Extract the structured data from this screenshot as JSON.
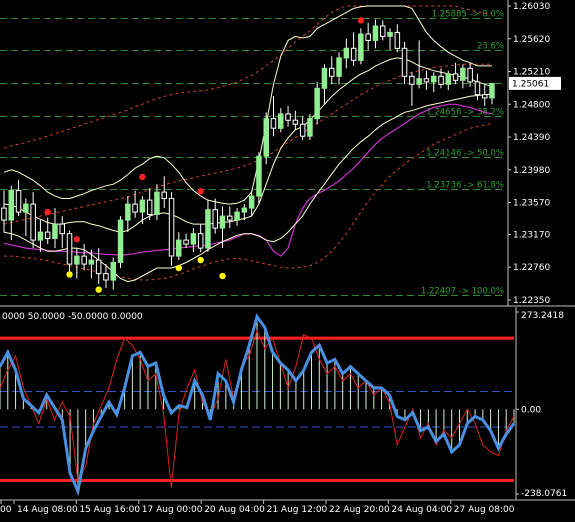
{
  "colors": {
    "background": "#000000",
    "frame": "#c0c0c0",
    "price_axis_text": "#ffffff",
    "fib_level": "#2e8b2e",
    "fib_label": "#2ea02e",
    "candle_bull": "#90ee90",
    "candle_bear": "#000000",
    "candle_wick": "#ffffff",
    "bollinger_inner": "#ffffd0",
    "bollinger_outer": "#cc4422",
    "envelope_low": "#cc33cc",
    "fractal_up": "#ff2020",
    "fractal_down": "#ffff00",
    "osc_main": "#4a90e2",
    "osc_signal": "#dd2222",
    "osc_bars": "#d0f0d0",
    "osc_band": "#ff2020",
    "osc_level": "#3355cc",
    "current_price_box": "#ffffff"
  },
  "chart_data": [
    {
      "type": "candlestick",
      "panel": "price",
      "y_ticks": [
        "1.26030",
        "1.25620",
        "1.25210",
        "1.24800",
        "1.24390",
        "1.23980",
        "1.23570",
        "1.23170",
        "1.22760",
        "1.22350"
      ],
      "ylim": [
        1.2235,
        1.2603
      ],
      "current_price": "1.25061",
      "fib_levels": [
        {
          "price": 1.25885,
          "label": "1.25885 -> 0.0%"
        },
        {
          "price": 1.25475,
          "label": "23.6%"
        },
        {
          "price": 1.25066,
          "label": ""
        },
        {
          "price": 1.24656,
          "label": "1.24656 -> 38.2%"
        },
        {
          "price": 1.24146,
          "label": "1.24146 -> 50.0%"
        },
        {
          "price": 1.23736,
          "label": "1.23736 -> 61.8%"
        },
        {
          "price": 1.22407,
          "label": "1.22407 -> 100.0%"
        }
      ],
      "candles": [
        [
          1.235,
          1.2372,
          1.232,
          1.2335
        ],
        [
          1.2335,
          1.2378,
          1.231,
          1.2372
        ],
        [
          1.2372,
          1.2385,
          1.234,
          1.2345
        ],
        [
          1.2345,
          1.2362,
          1.2315,
          1.2355
        ],
        [
          1.2355,
          1.237,
          1.23,
          1.231
        ],
        [
          1.231,
          1.2335,
          1.2295,
          1.232
        ],
        [
          1.232,
          1.2338,
          1.2305,
          1.2312
        ],
        [
          1.2312,
          1.235,
          1.23,
          1.233
        ],
        [
          1.233,
          1.234,
          1.23,
          1.2318
        ],
        [
          1.2318,
          1.2322,
          1.227,
          1.228
        ],
        [
          1.228,
          1.23,
          1.2262,
          1.229
        ],
        [
          1.229,
          1.2305,
          1.2272,
          1.228
        ],
        [
          1.228,
          1.2298,
          1.2262,
          1.2285
        ],
        [
          1.2285,
          1.23,
          1.2255,
          1.2268
        ],
        [
          1.2268,
          1.228,
          1.225,
          1.226
        ],
        [
          1.226,
          1.2288,
          1.2248,
          1.2282
        ],
        [
          1.2282,
          1.234,
          1.2275,
          1.2335
        ],
        [
          1.2335,
          1.2365,
          1.232,
          1.2355
        ],
        [
          1.2355,
          1.2372,
          1.2338,
          1.2345
        ],
        [
          1.2345,
          1.2365,
          1.233,
          1.236
        ],
        [
          1.236,
          1.2375,
          1.2335,
          1.2342
        ],
        [
          1.2342,
          1.238,
          1.2335,
          1.237
        ],
        [
          1.237,
          1.239,
          1.235,
          1.2362
        ],
        [
          1.2362,
          1.237,
          1.2278,
          1.229
        ],
        [
          1.229,
          1.232,
          1.2285,
          1.231
        ],
        [
          1.231,
          1.2318,
          1.23,
          1.2305
        ],
        [
          1.2305,
          1.2325,
          1.2295,
          1.2318
        ],
        [
          1.2318,
          1.233,
          1.2295,
          1.23
        ],
        [
          1.23,
          1.236,
          1.2295,
          1.2348
        ],
        [
          1.2348,
          1.2362,
          1.2318,
          1.2325
        ],
        [
          1.2325,
          1.2352,
          1.23,
          1.234
        ],
        [
          1.234,
          1.2352,
          1.2325,
          1.2335
        ],
        [
          1.2335,
          1.235,
          1.2328,
          1.2345
        ],
        [
          1.2345,
          1.2355,
          1.2335,
          1.235
        ],
        [
          1.235,
          1.2372,
          1.234,
          1.2365
        ],
        [
          1.2365,
          1.242,
          1.2355,
          1.2415
        ],
        [
          1.2415,
          1.247,
          1.2405,
          1.2462
        ],
        [
          1.2462,
          1.249,
          1.244,
          1.245
        ],
        [
          1.245,
          1.2475,
          1.2445,
          1.2468
        ],
        [
          1.2468,
          1.2478,
          1.2452,
          1.246
        ],
        [
          1.246,
          1.2472,
          1.2448,
          1.2455
        ],
        [
          1.2455,
          1.2465,
          1.2435,
          1.244
        ],
        [
          1.244,
          1.2468,
          1.2435,
          1.2462
        ],
        [
          1.2462,
          1.2508,
          1.2455,
          1.25
        ],
        [
          1.25,
          1.253,
          1.248,
          1.2525
        ],
        [
          1.2525,
          1.254,
          1.2505,
          1.2515
        ],
        [
          1.2515,
          1.2545,
          1.2505,
          1.2538
        ],
        [
          1.2538,
          1.2562,
          1.2525,
          1.255
        ],
        [
          1.255,
          1.257,
          1.2528,
          1.2535
        ],
        [
          1.2535,
          1.2575,
          1.253,
          1.2568
        ],
        [
          1.2568,
          1.2582,
          1.2548,
          1.256
        ],
        [
          1.256,
          1.2586,
          1.255,
          1.2578
        ],
        [
          1.2578,
          1.2585,
          1.256,
          1.2565
        ],
        [
          1.2565,
          1.2575,
          1.2548,
          1.257
        ],
        [
          1.257,
          1.258,
          1.2545,
          1.255
        ],
        [
          1.255,
          1.2558,
          1.2505,
          1.2515
        ],
        [
          1.2515,
          1.252,
          1.2478,
          1.2505
        ],
        [
          1.2505,
          1.256,
          1.25,
          1.2512
        ],
        [
          1.2512,
          1.2522,
          1.2498,
          1.2508
        ],
        [
          1.2508,
          1.252,
          1.2495,
          1.2515
        ],
        [
          1.2515,
          1.2525,
          1.25,
          1.2505
        ],
        [
          1.2505,
          1.2522,
          1.2498,
          1.2518
        ],
        [
          1.2518,
          1.2532,
          1.2505,
          1.251
        ],
        [
          1.251,
          1.253,
          1.25,
          1.2525
        ],
        [
          1.2525,
          1.2532,
          1.2502,
          1.2508
        ],
        [
          1.2508,
          1.2518,
          1.2485,
          1.2492
        ],
        [
          1.2492,
          1.2505,
          1.2478,
          1.2488
        ],
        [
          1.2488,
          1.2506,
          1.248,
          1.2506
        ]
      ],
      "bollinger_upper": [
        1.2395,
        1.2398,
        1.2395,
        1.239,
        1.2385,
        1.2378,
        1.237,
        1.2365,
        1.2362,
        1.2362,
        1.2365,
        1.2368,
        1.2372,
        1.2375,
        1.2378,
        1.238,
        1.2385,
        1.2392,
        1.24,
        1.2405,
        1.2412,
        1.2415,
        1.2413,
        1.2405,
        1.2395,
        1.2382,
        1.2372,
        1.2365,
        1.236,
        1.2358,
        1.2356,
        1.2355,
        1.2356,
        1.236,
        1.237,
        1.241,
        1.2455,
        1.2505,
        1.254,
        1.256,
        1.2565,
        1.2563,
        1.2565,
        1.2575,
        1.258,
        1.2585,
        1.259,
        1.2595,
        1.26,
        1.2602,
        1.2603,
        1.2603,
        1.2603,
        1.2603,
        1.2603,
        1.2603,
        1.26,
        1.2585,
        1.257,
        1.256,
        1.2552,
        1.2545,
        1.254,
        1.2535,
        1.2532,
        1.2528,
        1.2528,
        1.2528
      ],
      "bollinger_middle": [
        1.2355,
        1.2354,
        1.235,
        1.2345,
        1.234,
        1.2336,
        1.2332,
        1.233,
        1.233,
        1.2332,
        1.2333,
        1.2333,
        1.233,
        1.2328,
        1.2325,
        1.2322,
        1.232,
        1.2322,
        1.2328,
        1.2335,
        1.234,
        1.2343,
        1.2344,
        1.2342,
        1.2338,
        1.2333,
        1.233,
        1.233,
        1.233,
        1.2331,
        1.2332,
        1.2333,
        1.2335,
        1.2337,
        1.234,
        1.2355,
        1.238,
        1.2405,
        1.2425,
        1.2438,
        1.2448,
        1.2452,
        1.246,
        1.247,
        1.248,
        1.249,
        1.2498,
        1.2505,
        1.2512,
        1.2518,
        1.2522,
        1.2528,
        1.2532,
        1.2536,
        1.2538,
        1.2537,
        1.2533,
        1.2528,
        1.2525,
        1.2522,
        1.252,
        1.2518,
        1.2516,
        1.2514,
        1.2512,
        1.2508,
        1.2505,
        1.2502
      ],
      "bollinger_lower": [
        1.232,
        1.2318,
        1.2315,
        1.231,
        1.2305,
        1.23,
        1.2296,
        1.2296,
        1.2298,
        1.23,
        1.23,
        1.2298,
        1.2292,
        1.2285,
        1.2278,
        1.227,
        1.2262,
        1.2258,
        1.226,
        1.2265,
        1.227,
        1.2275,
        1.2275,
        1.2275,
        1.2278,
        1.2282,
        1.2287,
        1.2292,
        1.2298,
        1.2303,
        1.2308,
        1.2312,
        1.2316,
        1.2318,
        1.2318,
        1.2315,
        1.231,
        1.2308,
        1.2312,
        1.232,
        1.233,
        1.234,
        1.2355,
        1.2368,
        1.238,
        1.2393,
        1.2405,
        1.2415,
        1.2425,
        1.2433,
        1.244,
        1.2448,
        1.2455,
        1.246,
        1.2465,
        1.247,
        1.2472,
        1.2475,
        1.2478,
        1.248,
        1.2482,
        1.2484,
        1.2486,
        1.2488,
        1.249,
        1.2491,
        1.2492,
        1.2493
      ],
      "outer_upper": [
        1.2425,
        1.2428,
        1.243,
        1.2432,
        1.2435,
        1.2437,
        1.244,
        1.2443,
        1.2446,
        1.2449,
        1.2452,
        1.2455,
        1.2458,
        1.2461,
        1.2464,
        1.2467,
        1.247,
        1.2473,
        1.2477,
        1.248,
        1.2484,
        1.2487,
        1.249,
        1.2492,
        1.2494,
        1.2495,
        1.2496,
        1.2497,
        1.2498,
        1.25,
        1.2502,
        1.2505,
        1.2508,
        1.2512,
        1.2516,
        1.2522,
        1.2528,
        1.2535,
        1.2542,
        1.255,
        1.2558,
        1.2565,
        1.2572,
        1.258,
        1.2588,
        1.2595,
        1.26,
        1.2603,
        1.2603,
        1.2603,
        1.2603,
        1.2603,
        1.2603,
        1.2603,
        1.2603,
        1.2603,
        1.2603,
        1.2603,
        1.2603,
        1.2603,
        1.2603,
        1.2603,
        1.2603,
        1.26,
        1.2598,
        1.2596,
        1.2594,
        1.2593
      ],
      "outer_middle": [
        1.233,
        1.2332,
        1.2334,
        1.2336,
        1.2338,
        1.234,
        1.2342,
        1.2344,
        1.2346,
        1.2348,
        1.235,
        1.2352,
        1.2354,
        1.2356,
        1.2358,
        1.236,
        1.2362,
        1.2364,
        1.2367,
        1.237,
        1.2373,
        1.2376,
        1.2379,
        1.2382,
        1.2384,
        1.2386,
        1.2388,
        1.239,
        1.2392,
        1.2394,
        1.2396,
        1.2398,
        1.24,
        1.2403,
        1.2406,
        1.241,
        1.2415,
        1.242,
        1.2426,
        1.2432,
        1.2438,
        1.2444,
        1.245,
        1.2456,
        1.2462,
        1.2468,
        1.2474,
        1.248,
        1.2486,
        1.2492,
        1.2497,
        1.2502,
        1.2506,
        1.251,
        1.2514,
        1.2517,
        1.252,
        1.2522,
        1.2524,
        1.2526,
        1.2527,
        1.2528,
        1.2529,
        1.253,
        1.253,
        1.253,
        1.253,
        1.253
      ],
      "outer_lower": [
        1.229,
        1.229,
        1.2289,
        1.2288,
        1.2287,
        1.2286,
        1.2284,
        1.2282,
        1.228,
        1.2278,
        1.2276,
        1.2274,
        1.2272,
        1.227,
        1.2268,
        1.2266,
        1.2264,
        1.2262,
        1.2261,
        1.226,
        1.226,
        1.2261,
        1.2262,
        1.2264,
        1.2267,
        1.227,
        1.2274,
        1.2277,
        1.228,
        1.2283,
        1.2285,
        1.2287,
        1.2287,
        1.2286,
        1.2284,
        1.2282,
        1.228,
        1.2278,
        1.2276,
        1.2275,
        1.2275,
        1.2276,
        1.2278,
        1.2282,
        1.2288,
        1.2296,
        1.2306,
        1.2318,
        1.2332,
        1.2345,
        1.2358,
        1.237,
        1.238,
        1.239,
        1.2398,
        1.2405,
        1.2412,
        1.2418,
        1.2424,
        1.243,
        1.2434,
        1.2438,
        1.2442,
        1.2446,
        1.245,
        1.2452,
        1.2454,
        1.2456
      ],
      "magenta_band": [
        1.2306,
        1.2304,
        1.2302,
        1.23,
        1.2299,
        1.2298,
        1.2297,
        1.2296,
        1.2296,
        1.2296,
        1.2295,
        1.2294,
        1.2294,
        1.2293,
        1.2292,
        1.2292,
        1.2291,
        1.2292,
        1.2293,
        1.2295,
        1.2296,
        1.2297,
        1.2298,
        1.2299,
        1.23,
        1.2301,
        1.2302,
        1.2303,
        1.2304,
        1.2306,
        1.2308,
        1.231,
        1.2314,
        1.2318,
        1.2318,
        1.2316,
        1.231,
        1.2296,
        1.229,
        1.23,
        1.233,
        1.235,
        1.2362,
        1.2368,
        1.2372,
        1.2378,
        1.2384,
        1.2392,
        1.24,
        1.241,
        1.242,
        1.243,
        1.2438,
        1.2444,
        1.245,
        1.2456,
        1.2462,
        1.2468,
        1.2472,
        1.2476,
        1.2478,
        1.248,
        1.248,
        1.2478,
        1.2476,
        1.2473,
        1.247,
        1.2468
      ],
      "fractals_up": [
        [
          6,
          1.234
        ],
        [
          10,
          1.2306
        ],
        [
          19,
          1.2384
        ],
        [
          27,
          1.2366
        ],
        [
          49,
          1.258
        ]
      ],
      "fractals_down": [
        [
          9,
          1.2272
        ],
        [
          13,
          1.2253
        ],
        [
          24,
          1.228
        ],
        [
          27,
          1.229
        ],
        [
          30,
          1.227
        ]
      ]
    },
    {
      "type": "line",
      "panel": "oscillator",
      "header_label": "0000 50.0000 -50.0000 0.0000",
      "y_ticks": [
        "273.2418",
        "0.00",
        "-238.0761"
      ],
      "ylim": [
        -238.0761,
        273.2418
      ],
      "band_levels": [
        200,
        -200
      ],
      "dashed_levels": [
        50,
        -50
      ],
      "x_tick_labels": [
        "00",
        "14 Aug 08:00",
        "15 Aug 16:00",
        "17 Aug 00:00",
        "20 Aug 04:00",
        "21 Aug 12:00",
        "22 Aug 20:00",
        "24 Aug 04:00",
        "27 Aug 08:00"
      ],
      "main_series": [
        120,
        160,
        110,
        30,
        10,
        -10,
        40,
        5,
        -30,
        -180,
        -230,
        -110,
        -60,
        -20,
        20,
        -15,
        60,
        150,
        160,
        120,
        130,
        40,
        -10,
        10,
        5,
        80,
        40,
        -30,
        100,
        80,
        20,
        110,
        180,
        260,
        230,
        160,
        130,
        110,
        80,
        110,
        160,
        180,
        130,
        140,
        100,
        120,
        100,
        80,
        60,
        60,
        40,
        -20,
        -30,
        -10,
        -60,
        -50,
        -90,
        -70,
        -120,
        -100,
        -40,
        -20,
        -30,
        -60,
        -110,
        -70,
        -40
      ],
      "signal_series": [
        60,
        110,
        150,
        60,
        10,
        -40,
        30,
        -30,
        20,
        -20,
        -200,
        -160,
        -40,
        10,
        60,
        140,
        200,
        180,
        140,
        80,
        100,
        -10,
        -220,
        -10,
        60,
        110,
        20,
        -20,
        30,
        140,
        30,
        120,
        150,
        220,
        170,
        200,
        130,
        60,
        120,
        210,
        200,
        140,
        100,
        120,
        80,
        100,
        60,
        80,
        40,
        60,
        20,
        -100,
        -50,
        0,
        -80,
        -40,
        -100,
        -60,
        -80,
        -40,
        0,
        -40,
        -100,
        -120,
        -130,
        -60,
        -20
      ]
    }
  ]
}
